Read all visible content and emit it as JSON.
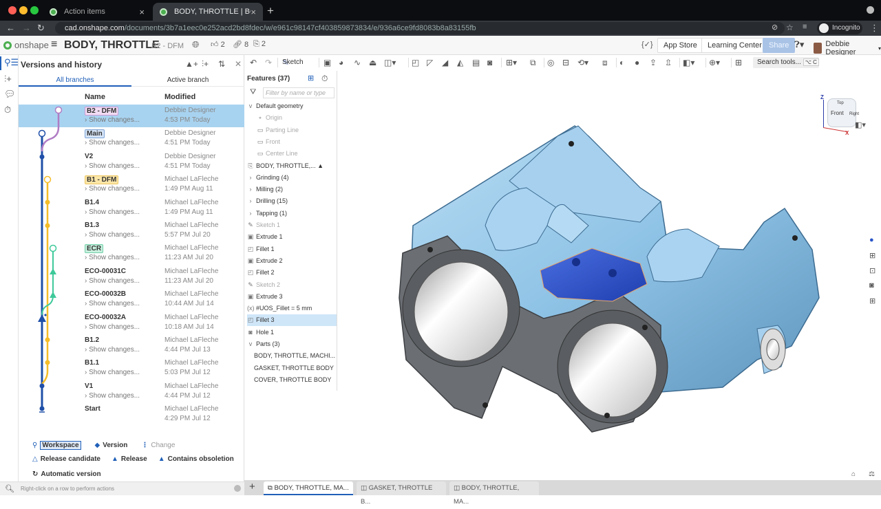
{
  "browser": {
    "tabs": [
      {
        "label": "Action items",
        "active": false
      },
      {
        "label": "BODY, THROTTLE | BODY, TH",
        "active": true
      }
    ],
    "url_host": "cad.onshape.com",
    "url_path": "/documents/3b7a1eec0e252acd2bd8fdec/w/e961c98147cf403859873834/e/936a6ce9fd8083b8a83155fb",
    "profile": "Incognito"
  },
  "header": {
    "logo": "onshape",
    "doc_title": "BODY, THROTTLE",
    "doc_version": "B2 - DFM",
    "likes": "2",
    "links": "8",
    "copies": "2",
    "variables_icon": "{✓}",
    "app_store": "App Store",
    "learning_center": "Learning Center",
    "share": "Share",
    "user": "Debbie Designer"
  },
  "versions_panel": {
    "title": "Versions and history",
    "tabs": [
      "All branches",
      "Active branch"
    ],
    "col_name": "Name",
    "col_modified": "Modified",
    "rows": [
      {
        "name": "B2 - DFM",
        "show": "Show changes...",
        "author": "Debbie Designer",
        "date": "4:53 PM Today",
        "tag": "pink",
        "selected": true
      },
      {
        "name": "Main",
        "show": "Show changes...",
        "author": "Debbie Designer",
        "date": "4:51 PM Today",
        "tag": "blue"
      },
      {
        "name": "V2",
        "show": "Show changes...",
        "author": "Debbie Designer",
        "date": "4:51 PM Today"
      },
      {
        "name": "B1 - DFM",
        "show": "Show changes...",
        "author": "Michael LaFleche",
        "date": "1:49 PM Aug 11",
        "tag": "yellow"
      },
      {
        "name": "B1.4",
        "show": "Show changes...",
        "author": "Michael LaFleche",
        "date": "1:49 PM Aug 11"
      },
      {
        "name": "B1.3",
        "show": "Show changes...",
        "author": "Michael LaFleche",
        "date": "5:57 PM Jul 20"
      },
      {
        "name": "ECR",
        "show": "Show changes...",
        "author": "Michael LaFleche",
        "date": "11:23 AM Jul 20",
        "tag": "green"
      },
      {
        "name": "ECO-00031C",
        "show": "Show changes...",
        "author": "Michael LaFleche",
        "date": "11:23 AM Jul 20"
      },
      {
        "name": "ECO-00032B",
        "show": "Show changes...",
        "author": "Michael LaFleche",
        "date": "10:44 AM Jul 14"
      },
      {
        "name": "ECO-00032A",
        "show": "Show changes...",
        "author": "Michael LaFleche",
        "date": "10:18 AM Jul 14"
      },
      {
        "name": "B1.2",
        "show": "Show changes...",
        "author": "Michael LaFleche",
        "date": "4:44 PM Jul 13"
      },
      {
        "name": "B1.1",
        "show": "Show changes...",
        "author": "Michael LaFleche",
        "date": "5:03 PM Jul 12"
      },
      {
        "name": "V1",
        "show": "Show changes...",
        "author": "Michael LaFleche",
        "date": "4:44 PM Jul 12"
      },
      {
        "name": "Start",
        "show": "",
        "author": "Michael LaFleche",
        "date": "4:29 PM Jul 12"
      }
    ],
    "legend": {
      "workspace": "Workspace",
      "version": "Version",
      "change": "Change",
      "release_candidate": "Release candidate",
      "release": "Release",
      "contains_obsoletion": "Contains obsoletion",
      "automatic_version": "Automatic version"
    },
    "status": "Right-click on a row to perform actions"
  },
  "toolbar": {
    "sketch": "Sketch",
    "search": "Search tools...",
    "search_shortcut": "⌥ C"
  },
  "features": {
    "title": "Features (37)",
    "filter_placeholder": "Filter by name or type",
    "items": [
      {
        "label": "Default geometry",
        "icon": "v",
        "kind": "group"
      },
      {
        "label": "Origin",
        "icon": "∘",
        "kind": "child",
        "dim": true
      },
      {
        "label": "Parting Line",
        "icon": "▭",
        "kind": "child",
        "dim": true
      },
      {
        "label": "Front",
        "icon": "▭",
        "kind": "child",
        "dim": true
      },
      {
        "label": "Center Line",
        "icon": "▭",
        "kind": "child",
        "dim": true
      },
      {
        "label": "BODY, THROTTLE,... ▲",
        "icon": "⎘",
        "kind": "item"
      },
      {
        "label": "Grinding (4)",
        "icon": "›",
        "kind": "item"
      },
      {
        "label": "Milling (2)",
        "icon": "›",
        "kind": "item"
      },
      {
        "label": "Drilling (15)",
        "icon": "›",
        "kind": "item"
      },
      {
        "label": "Tapping (1)",
        "icon": "›",
        "kind": "item"
      },
      {
        "label": "Sketch 1",
        "icon": "✎",
        "kind": "item",
        "dim": true
      },
      {
        "label": "Extrude 1",
        "icon": "▣",
        "kind": "item"
      },
      {
        "label": "Fillet 1",
        "icon": "◰",
        "kind": "item"
      },
      {
        "label": "Extrude 2",
        "icon": "▣",
        "kind": "item"
      },
      {
        "label": "Fillet 2",
        "icon": "◰",
        "kind": "item"
      },
      {
        "label": "Sketch 2",
        "icon": "✎",
        "kind": "item",
        "dim": true
      },
      {
        "label": "Extrude 3",
        "icon": "▣",
        "kind": "item"
      },
      {
        "label": "#UOS_Fillet = 5 mm",
        "icon": "(x)",
        "kind": "item"
      },
      {
        "label": "Fillet 3",
        "icon": "◰",
        "kind": "item",
        "selected": true
      },
      {
        "label": "Hole 1",
        "icon": "◙",
        "kind": "item"
      },
      {
        "label": "Parts (3)",
        "icon": "v",
        "kind": "group"
      },
      {
        "label": "BODY, THROTTLE, MACHI...",
        "icon": "",
        "kind": "part"
      },
      {
        "label": "GASKET, THROTTLE BODY",
        "icon": "",
        "kind": "part"
      },
      {
        "label": "COVER, THROTTLE BODY",
        "icon": "",
        "kind": "part"
      }
    ]
  },
  "viewcube": {
    "top": "Top",
    "front": "Front",
    "right": "Right",
    "z": "Z",
    "x": "X"
  },
  "doc_tabs": [
    {
      "label": "BODY, THROTTLE, MA...",
      "active": true
    },
    {
      "label": "GASKET, THROTTLE B...",
      "active": false
    },
    {
      "label": "BODY, THROTTLE, MA...",
      "active": false
    }
  ],
  "colors": {
    "accent": "#1f5fb8",
    "part_blue": "#8fc3e6",
    "selected_row": "#a8d3f0",
    "branch_pink": "#b07cc4",
    "branch_yellow": "#f5bd2a",
    "branch_green": "#3ec99a"
  }
}
